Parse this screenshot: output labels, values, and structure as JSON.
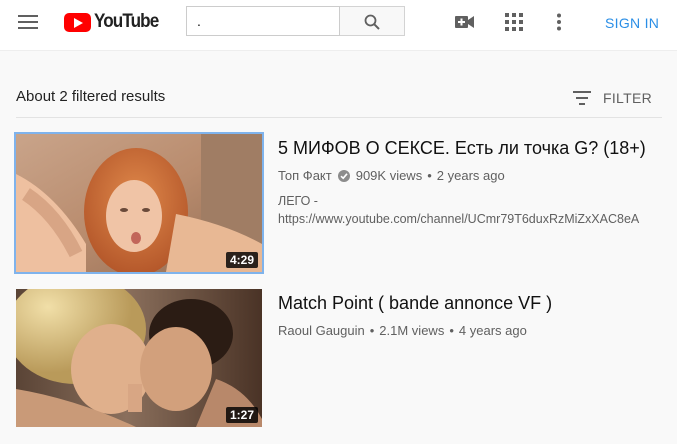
{
  "header": {
    "logo_text": "YouTube",
    "search_value": ".",
    "sign_in_label": "SIGN IN",
    "icons": [
      "menu-icon",
      "search-icon",
      "video-camera-icon",
      "apps-grid-icon",
      "more-vert-icon"
    ]
  },
  "results": {
    "summary": "About 2 filtered results",
    "filter_label": "FILTER",
    "items": [
      {
        "title": "5 МИФОВ О СЕКСЕ. Есть ли точка G? (18+)",
        "channel": "Топ Факт",
        "verified": true,
        "views": "909K views",
        "age": "2 years ago",
        "description_line1": "ЛЕГО -",
        "description_line2": "https://www.youtube.com/channel/UCmr79T6duxRzMiZxXAC8eA",
        "duration": "4:29",
        "selected": true
      },
      {
        "title": "Match Point ( bande annonce VF )",
        "channel": "Raoul Gauguin",
        "verified": false,
        "views": "2.1M views",
        "age": "4 years ago",
        "duration": "1:27",
        "selected": false
      }
    ]
  },
  "colors": {
    "brand_red": "#ff0000",
    "accent_blue": "#2a8ee6",
    "selection_outline": "#7fb3ec"
  }
}
